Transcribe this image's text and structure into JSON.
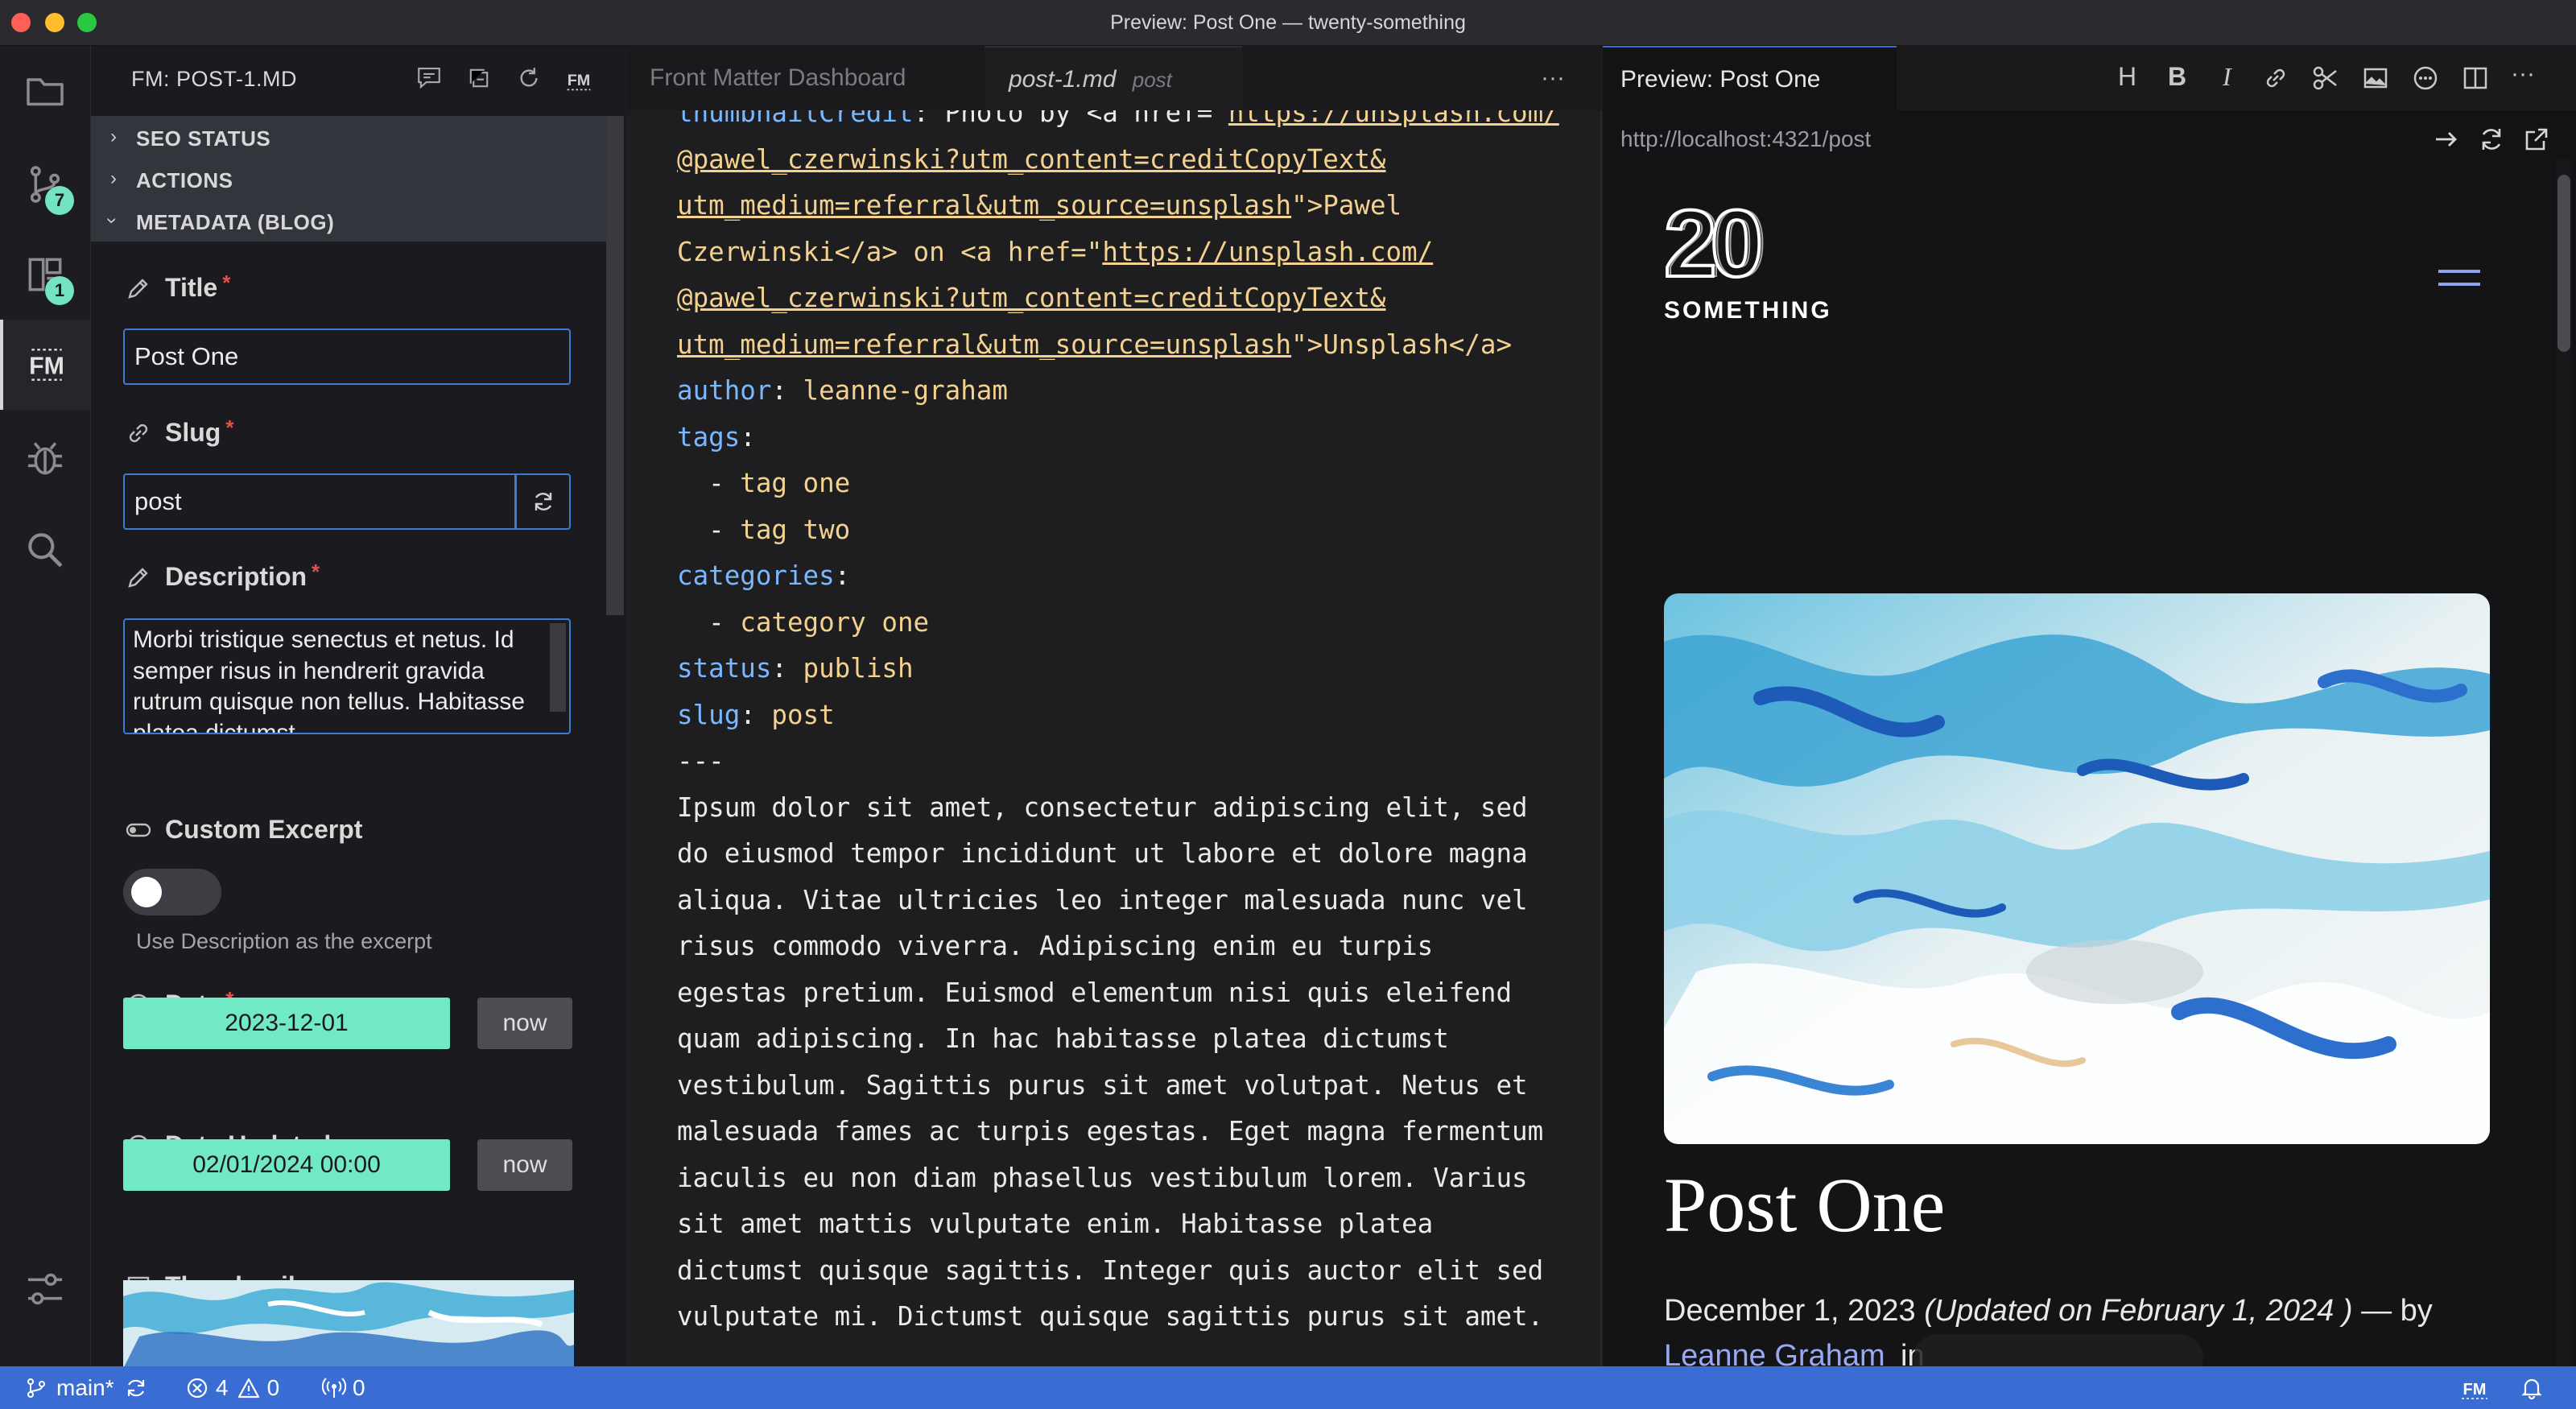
{
  "window": {
    "title": "Preview: Post One — twenty-something"
  },
  "activity_bar": {
    "scm_badge": "7",
    "fm_badge": "1"
  },
  "sidebar": {
    "title": "FM: POST-1.MD",
    "sections": [
      {
        "label": "SEO STATUS",
        "expanded": false
      },
      {
        "label": "ACTIONS",
        "expanded": false
      },
      {
        "label": "METADATA (BLOG)",
        "expanded": true
      }
    ],
    "required_mark": "*",
    "fields": {
      "title": {
        "label": "Title",
        "value": "Post One"
      },
      "slug": {
        "label": "Slug",
        "value": "post"
      },
      "description": {
        "label": "Description",
        "value": "Morbi tristique senectus et netus. Id semper risus in hendrerit gravida rutrum quisque non tellus. Habitasse platea dictumst"
      },
      "custom_excerpt": {
        "label": "Custom Excerpt",
        "enabled": false,
        "helper": "Use Description as the excerpt"
      },
      "date": {
        "label": "Date",
        "value": "2023-12-01",
        "now_label": "now"
      },
      "date_updated": {
        "label": "Date Updated",
        "value": "02/01/2024 00:00",
        "now_label": "now"
      },
      "thumbnail": {
        "label": "Thumbnail"
      }
    }
  },
  "editor": {
    "tabs": [
      {
        "label": "Front Matter Dashboard",
        "active": false
      },
      {
        "label": "post-1.md",
        "description": "post",
        "active": true
      }
    ],
    "more_label": "···",
    "lines": [
      [
        {
          "c": "k",
          "t": "thumbnailCredit"
        },
        {
          "c": "w",
          "t": ": Photo by <a href=\""
        },
        {
          "c": "u",
          "t": "https://unsplash.com/"
        }
      ],
      [
        {
          "c": "u",
          "t": "@pawel_czerwinski?utm_content=creditCopyText&"
        }
      ],
      [
        {
          "c": "u",
          "t": "utm_medium=referral&utm_source=unsplash"
        },
        {
          "c": "v",
          "t": "\">Pawel"
        }
      ],
      [
        {
          "c": "v",
          "t": "Czerwinski</a> on <a href=\""
        },
        {
          "c": "u",
          "t": "https://unsplash.com/"
        }
      ],
      [
        {
          "c": "u",
          "t": "@pawel_czerwinski?utm_content=creditCopyText&"
        }
      ],
      [
        {
          "c": "u",
          "t": "utm_medium=referral&utm_source=unsplash"
        },
        {
          "c": "v",
          "t": "\">Unsplash</a>"
        }
      ],
      [
        {
          "c": "k",
          "t": "author"
        },
        {
          "c": "w",
          "t": ": "
        },
        {
          "c": "v",
          "t": "leanne-graham"
        }
      ],
      [
        {
          "c": "k",
          "t": "tags"
        },
        {
          "c": "w",
          "t": ":"
        }
      ],
      [
        {
          "c": "w",
          "t": "  - "
        },
        {
          "c": "v",
          "t": "tag one"
        }
      ],
      [
        {
          "c": "w",
          "t": "  - "
        },
        {
          "c": "v",
          "t": "tag two"
        }
      ],
      [
        {
          "c": "k",
          "t": "categories"
        },
        {
          "c": "w",
          "t": ":"
        }
      ],
      [
        {
          "c": "w",
          "t": "  - "
        },
        {
          "c": "v",
          "t": "category one"
        }
      ],
      [
        {
          "c": "k",
          "t": "status"
        },
        {
          "c": "w",
          "t": ": "
        },
        {
          "c": "v",
          "t": "publish"
        }
      ],
      [
        {
          "c": "k",
          "t": "slug"
        },
        {
          "c": "w",
          "t": ": "
        },
        {
          "c": "v",
          "t": "post"
        }
      ],
      [
        {
          "c": "w",
          "t": "---"
        }
      ],
      [
        {
          "c": "w",
          "t": "Ipsum dolor sit amet, consectetur adipiscing elit, sed"
        }
      ],
      [
        {
          "c": "w",
          "t": "do eiusmod tempor incididunt ut labore et dolore magna"
        }
      ],
      [
        {
          "c": "w",
          "t": "aliqua. Vitae ultricies leo integer malesuada nunc vel"
        }
      ],
      [
        {
          "c": "w",
          "t": "risus commodo viverra. Adipiscing enim eu turpis"
        }
      ],
      [
        {
          "c": "w",
          "t": "egestas pretium. Euismod elementum nisi quis eleifend"
        }
      ],
      [
        {
          "c": "w",
          "t": "quam adipiscing. In hac habitasse platea dictumst"
        }
      ],
      [
        {
          "c": "w",
          "t": "vestibulum. Sagittis purus sit amet volutpat. Netus et"
        }
      ],
      [
        {
          "c": "w",
          "t": "malesuada fames ac turpis egestas. Eget magna fermentum"
        }
      ],
      [
        {
          "c": "w",
          "t": "iaculis eu non diam phasellus vestibulum lorem. Varius"
        }
      ],
      [
        {
          "c": "w",
          "t": "sit amet mattis vulputate enim. Habitasse platea"
        }
      ],
      [
        {
          "c": "w",
          "t": "dictumst quisque sagittis. Integer quis auctor elit sed"
        }
      ],
      [
        {
          "c": "w",
          "t": "vulputate mi. Dictumst quisque sagittis purus sit amet."
        }
      ]
    ]
  },
  "preview": {
    "tab_label": "Preview: Post One",
    "url": "http://localhost:4321/post",
    "site_logo_number": "20",
    "site_logo_word": "SOMETHING",
    "post_title": "Post One",
    "post_date": "December 1, 2023",
    "post_updated": "(Updated on February 1, 2024 )",
    "post_by": "— by",
    "post_author": "Leanne Graham",
    "post_after_author": "in"
  },
  "statusbar": {
    "branch": "main*",
    "errors": "4",
    "warnings": "0",
    "ports": "0"
  },
  "colors": {
    "accent": "#3a6dd4",
    "badge": "#73e3c1",
    "date_fill": "#72e9c5",
    "yaml_key": "#79b8ff",
    "yaml_value": "#f3d28f",
    "required": "#e0524a"
  }
}
